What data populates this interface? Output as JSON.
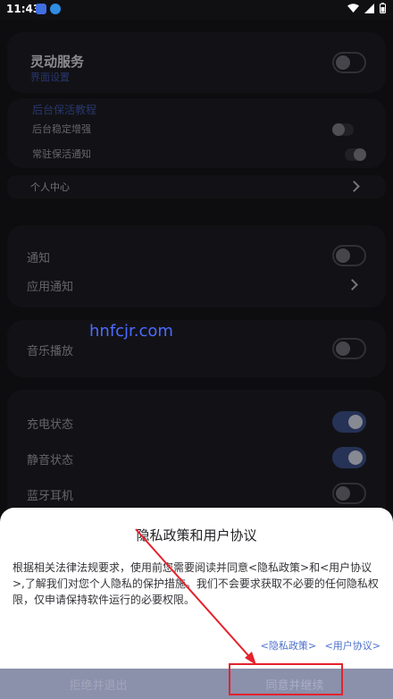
{
  "status_bar": {
    "time": "11:43"
  },
  "service_card": {
    "title": "灵动服务",
    "subtitle": "界面设置"
  },
  "keepalive_card": {
    "header": "后台保活教程",
    "items": [
      {
        "label": "后台稳定增强"
      },
      {
        "label": "常驻保活通知"
      }
    ]
  },
  "personal_center": {
    "label": "个人中心"
  },
  "notify_card": {
    "items": [
      {
        "label": "通知"
      },
      {
        "label": "应用通知"
      }
    ]
  },
  "music_card": {
    "label": "音乐播放"
  },
  "status_card": {
    "items": [
      {
        "label": "充电状态"
      },
      {
        "label": "静音状态"
      },
      {
        "label": "蓝牙耳机"
      }
    ]
  },
  "watermark": "hnfcjr.com",
  "dialog": {
    "title": "隐私政策和用户协议",
    "body": "根据相关法律法规要求，使用前您需要阅读并同意<隐私政策>和<用户协议>,了解我们对您个人隐私的保护措施。我们不会要求获取不必要的任何隐私权限，仅申请保持软件运行的必要权限。",
    "privacy_link": "<隐私政策>",
    "user_link": "<用户协议>",
    "reject_label": "拒绝并退出",
    "agree_label": "同意并继续"
  },
  "colors": {
    "accent": "#3b4d84",
    "highlight": "#e4222c",
    "link": "#4a6fc9"
  }
}
